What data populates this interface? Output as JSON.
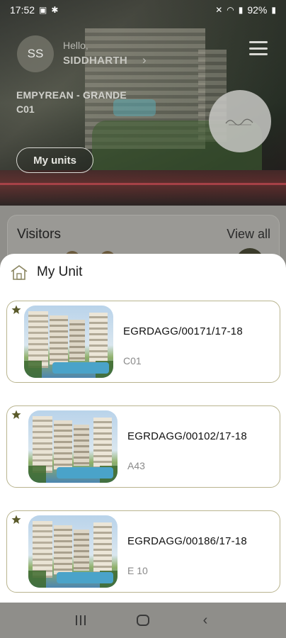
{
  "status_bar": {
    "time": "17:52",
    "battery": "92%"
  },
  "header": {
    "avatar_initials": "SS",
    "greeting": "Hello,",
    "user_name": "SIDDHARTH",
    "project_name": "EMPYREAN - GRANDE",
    "project_unit": "C01",
    "my_units_label": "My units"
  },
  "visitors": {
    "title": "Visitors",
    "view_all_label": "View all"
  },
  "sheet": {
    "title": "My Unit",
    "units": [
      {
        "id": "EGRDAGG/00171/17-18",
        "code": "C01"
      },
      {
        "id": "EGRDAGG/00102/17-18",
        "code": "A43"
      },
      {
        "id": "EGRDAGG/00186/17-18",
        "code": "E 10"
      }
    ]
  },
  "colors": {
    "card_border": "#b9b48f",
    "star": "#5a5a2a"
  }
}
